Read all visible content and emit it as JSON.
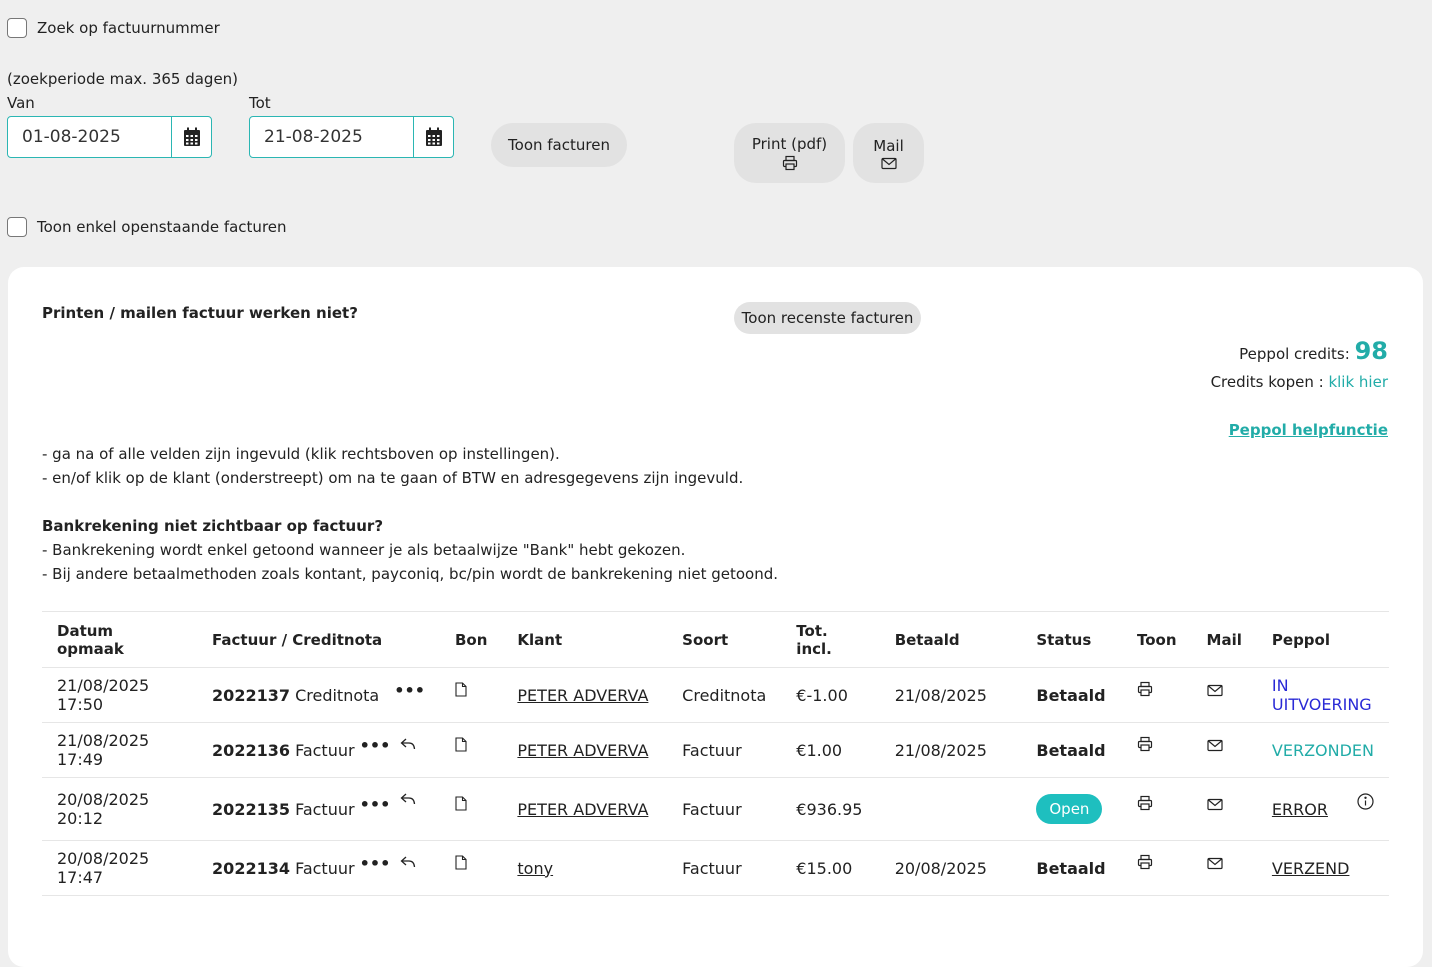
{
  "search_by_invoice_label": "Zoek op factuurnummer",
  "period_note": "(zoekperiode max. 365 dagen)",
  "from_label": "Van",
  "to_label": "Tot",
  "from_date": "01-08-2025",
  "to_date": "21-08-2025",
  "show_invoices_button": "Toon facturen",
  "print_button": "Print (pdf)",
  "mail_button": "Mail",
  "open_only_label": "Toon enkel openstaande facturen",
  "help_title": "Printen / mailen factuur werken niet?",
  "recent_button": "Toon recenste facturen",
  "peppol_credits_label": "Peppol credits:",
  "peppol_credits_value": "98",
  "credits_buy_label": "Credits kopen :",
  "credits_buy_link": "klik hier",
  "peppol_help_link": "Peppol helpfunctie",
  "help_line1": "- ga na of alle velden zijn ingevuld (klik rechtsboven op instellingen).",
  "help_line2": "- en/of klik op de klant (onderstreept) om na te gaan of BTW en adresgegevens zijn ingevuld.",
  "bank_title": "Bankrekening niet zichtbaar op factuur?",
  "bank_line1": "- Bankrekening wordt enkel getoond wanneer je als betaalwijze \"Bank\" hebt gekozen.",
  "bank_line2": "- Bij andere betaalmethoden zoals kontant, payconiq, bc/pin wordt de bankrekening niet getoond.",
  "table": {
    "headers": [
      "Datum opmaak",
      "Factuur / Creditnota",
      "Bon",
      "Klant",
      "Soort",
      "Tot. incl.",
      "Betaald",
      "Status",
      "Toon",
      "Mail",
      "Peppol"
    ],
    "rows": [
      {
        "date": "21/08/2025 17:50",
        "number": "2022137",
        "doc_type": "Creditnota",
        "client": "PETER ADVERVA",
        "kind": "Creditnota",
        "total": "€-1.00",
        "paid": "21/08/2025",
        "status": "Betaald",
        "peppol": "IN UITVOERING"
      },
      {
        "date": "21/08/2025 17:49",
        "number": "2022136",
        "doc_type": "Factuur",
        "client": "PETER ADVERVA",
        "kind": "Factuur",
        "total": "€1.00",
        "paid": "21/08/2025",
        "status": "Betaald",
        "peppol": "VERZONDEN"
      },
      {
        "date": "20/08/2025 20:12",
        "number": "2022135",
        "doc_type": "Factuur",
        "client": "PETER ADVERVA",
        "kind": "Factuur",
        "total": "€936.95",
        "paid": "",
        "status": "Open",
        "peppol": "ERROR"
      },
      {
        "date": "20/08/2025 17:47",
        "number": "2022134",
        "doc_type": "Factuur",
        "client": "tony",
        "kind": "Factuur",
        "total": "€15.00",
        "paid": "20/08/2025",
        "status": "Betaald",
        "peppol": "VERZEND"
      }
    ]
  },
  "colors": {
    "accent": "#22aca8",
    "blue_status": "#2a2ad6",
    "open_badge": "#1ebfbf"
  }
}
